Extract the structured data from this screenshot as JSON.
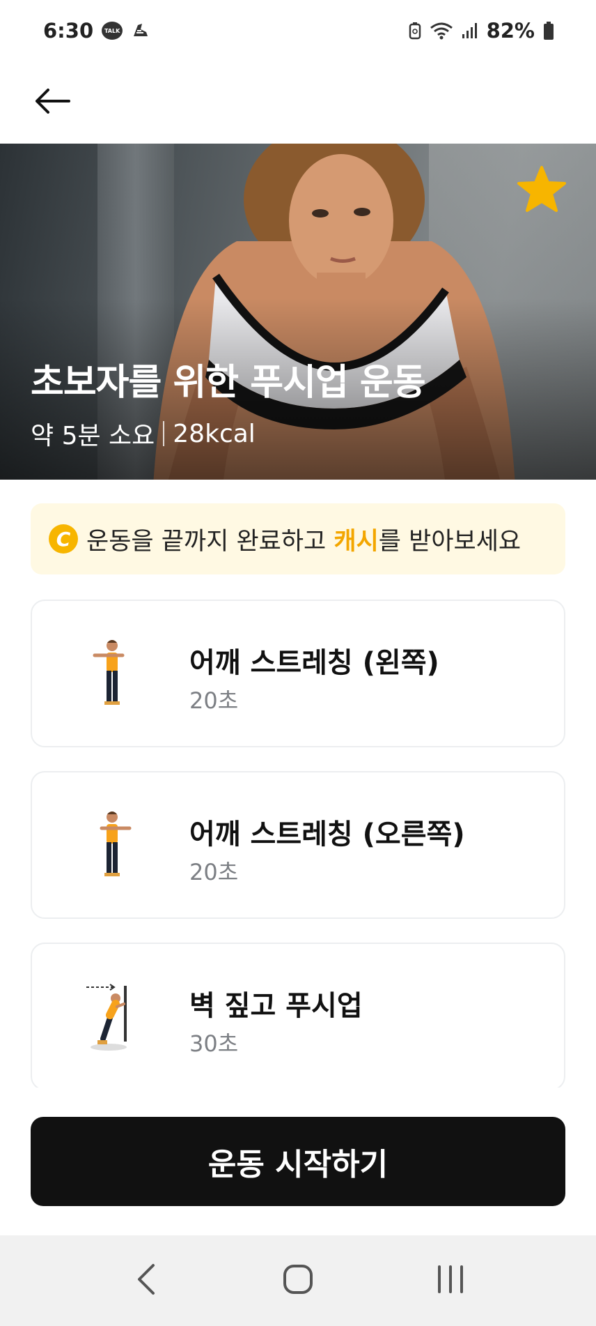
{
  "status_bar": {
    "time": "6:30",
    "talk_badge": "TALK",
    "battery": "82%"
  },
  "header": {
    "back_icon": "arrow-left-icon"
  },
  "hero": {
    "title": "초보자를 위한 푸시업 운동",
    "duration": "약 5분 소요",
    "calories": "28kcal",
    "favorite_icon": "star-icon",
    "favorite_color": "#f7b500"
  },
  "cash_banner": {
    "coin_letter": "C",
    "text_before": "운동을 끝까지 완료하고 ",
    "highlight": "캐시",
    "text_after": "를 받아보세요",
    "highlight_color": "#f3a600"
  },
  "exercises": [
    {
      "name": "어깨 스트레칭 (왼쪽)",
      "duration": "20초"
    },
    {
      "name": "어깨 스트레칭 (오른쪽)",
      "duration": "20초"
    },
    {
      "name": "벽 짚고 푸시업",
      "duration": "30초"
    }
  ],
  "start_button": {
    "label": "운동 시작하기"
  },
  "nav": {
    "back": "nav-back-icon",
    "home": "nav-home-icon",
    "recents": "nav-recents-icon"
  }
}
